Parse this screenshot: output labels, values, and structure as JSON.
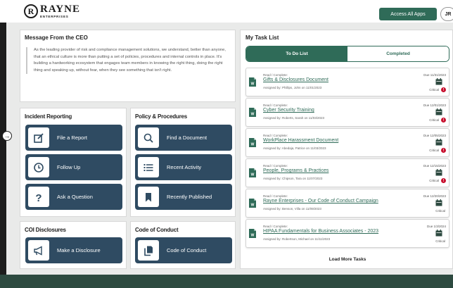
{
  "header": {
    "logo_mark": "R",
    "logo_name": "RAYNE",
    "logo_sub": "ENTERPRISES",
    "access_button": "Access All Apps",
    "avatar_initials": "JR"
  },
  "ceo": {
    "title": "Message From the CEO",
    "body": "As the leading provider of risk and compliance management solutions, we understand, better than anyone, that an ethical culture is more than putting a set of policies, procedures and internal controls in place. It's building a hardworking ecosystem that engages team members in knowing the right thing, doing the right thing and speaking up, without fear, when they see something that isn't right."
  },
  "incident": {
    "title": "Incident Reporting",
    "tiles": [
      {
        "label": "File a Report",
        "icon": "edit-icon"
      },
      {
        "label": "Follow Up",
        "icon": "clock-icon"
      },
      {
        "label": "Ask a Question",
        "icon": "question-icon"
      }
    ]
  },
  "policy": {
    "title": "Policy & Procedures",
    "tiles": [
      {
        "label": "Find a Document",
        "icon": "search-icon"
      },
      {
        "label": "Recent Activity",
        "icon": "list-icon"
      },
      {
        "label": "Recently Published",
        "icon": "bookmark-icon"
      }
    ]
  },
  "coi": {
    "title": "COI Disclosures",
    "tile": {
      "label": "Make a Disclosure",
      "icon": "megaphone-icon"
    }
  },
  "conduct": {
    "title": "Code of Conduct",
    "tile": {
      "label": "Code of Conduct",
      "icon": "copy-document-icon"
    }
  },
  "tasks": {
    "title": "My Task List",
    "tab_todo": "To Do List",
    "tab_completed": "Completed",
    "load_more": "Load More Tasks",
    "items": [
      {
        "kind": "Read / Complete:",
        "name": "Gifts & Disclosures Document",
        "assigned": "Assigned by: Phillips, John on 11/01/2023",
        "due": "Due 11/31/2023",
        "priority": "Critical",
        "critical": true
      },
      {
        "kind": "Read / Complete:",
        "name": "Cyber Security Training",
        "assigned": "Assigned by: Roberts, Sarah on 11/03/2023",
        "due": "Due 12/01/2023",
        "priority": "Critical",
        "critical": true
      },
      {
        "kind": "Read / Complete:",
        "name": "WorkPlace Harassment Document",
        "assigned": "Assigned by: Abedaja, Patrice on 11/03/2023",
        "due": "Due 12/05/2023",
        "priority": "Critical",
        "critical": true
      },
      {
        "kind": "Read / Complete:",
        "name": "People, Programs & Practices",
        "assigned": "Assigned by: Chipson, Tara on 11/07/2023",
        "due": "Due 12/15/2023",
        "priority": "Critical",
        "critical": true
      },
      {
        "kind": "Read / Complete:",
        "name": "Rayne Enterprises - Our Code of Conduct Campaign",
        "assigned": "Assigned by: Benson, Villa on 11/09/2023",
        "due": "Due 12/20/2023",
        "priority": "Critical",
        "critical": false
      },
      {
        "kind": "Read / Complete:",
        "name": "HIPAA Fundamentals for Business Associates - 2023",
        "assigned": "Assigned by: Robertson, Michael on 11/11/2023",
        "due": "Due 1/3/2024",
        "priority": "Critical",
        "critical": false
      }
    ]
  },
  "colors": {
    "brand_green": "#2f6b58",
    "tile_navy": "#2f4b62",
    "critical_red": "#c8102e",
    "footer_green": "#2d4a40"
  }
}
